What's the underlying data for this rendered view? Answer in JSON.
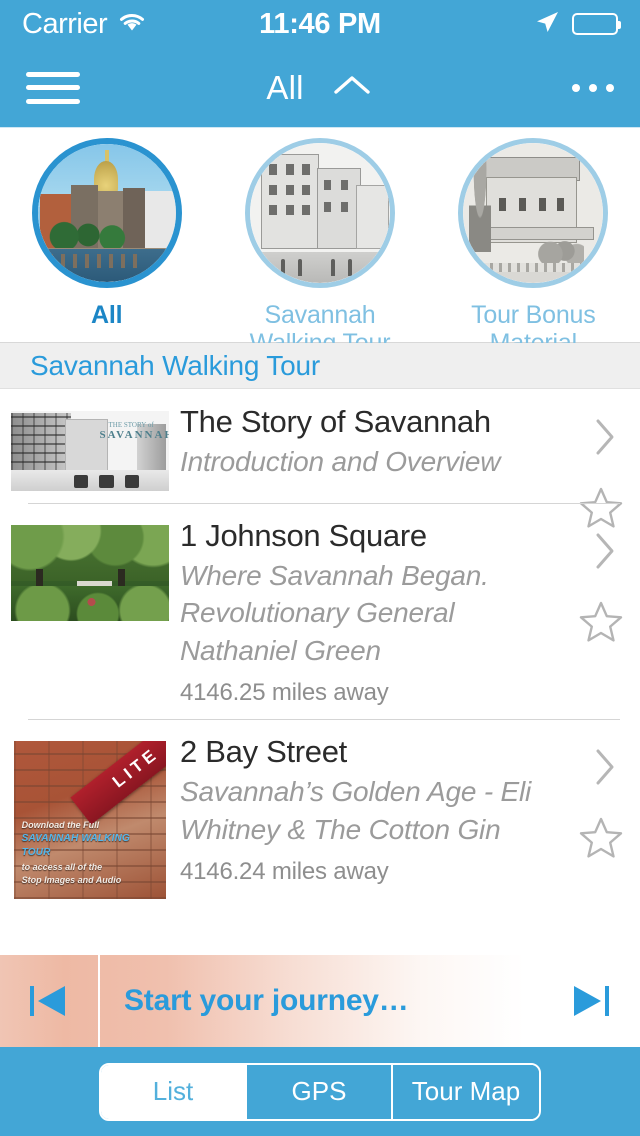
{
  "status_bar": {
    "carrier": "Carrier",
    "wifi_icon": "wifi-icon",
    "time": "11:46 PM",
    "location_icon": "location-arrow-icon",
    "battery_icon": "battery-icon"
  },
  "nav_bar": {
    "menu_icon": "hamburger-menu-icon",
    "title": "All",
    "chevron_icon": "chevron-up-icon",
    "more_icon": "more-options-icon"
  },
  "categories": [
    {
      "label": "All",
      "selected": true,
      "thumb": "savannah-river-street-photo"
    },
    {
      "label": "Savannah Walking Tour",
      "selected": false,
      "thumb": "broughton-street-engraving"
    },
    {
      "label": "Tour Bonus Material",
      "selected": false,
      "thumb": "historic-house-engraving"
    }
  ],
  "section": {
    "title": "Savannah Walking Tour"
  },
  "list": {
    "items": [
      {
        "title": "The Story of Savannah",
        "subtitle": "Introduction and Overview",
        "distance": "",
        "thumb": "vintage-street-photo",
        "thumb_logo_top": "THE STORY of",
        "thumb_logo_main": "SAVANNAH",
        "thumb_logo_sub": "",
        "chevron_icon": "chevron-right-icon",
        "star_icon": "star-outline-icon"
      },
      {
        "title": "1 Johnson Square",
        "subtitle": "Where Savannah Began.  Revolutionary General Nathaniel Green",
        "distance": "4146.25 miles away",
        "thumb": "johnson-square-park-photo",
        "chevron_icon": "chevron-right-icon",
        "star_icon": "star-outline-icon"
      },
      {
        "title": "2 Bay Street",
        "subtitle": "Savannah’s Golden Age  -  Eli Whitney & The Cotton Gin",
        "distance": "4146.24 miles away",
        "thumb": "brick-wall-lite-promo",
        "thumb_badge": "LITE",
        "thumb_promo_line1": "Download the Full",
        "thumb_promo_line2": "SAVANNAH WALKING TOUR",
        "thumb_promo_line3": "to access all of the",
        "thumb_promo_line4": "Stop Images and Audio",
        "chevron_icon": "chevron-right-icon",
        "star_icon": "star-outline-icon"
      }
    ]
  },
  "player": {
    "prev_icon": "skip-previous-icon",
    "message": "Start your journey…",
    "next_icon": "skip-next-icon"
  },
  "tab_bar": {
    "tabs": [
      {
        "label": "List",
        "active": true
      },
      {
        "label": "GPS",
        "active": false
      },
      {
        "label": "Tour Map",
        "active": false
      }
    ]
  },
  "colors": {
    "header_blue": "#43A6D6",
    "accent_blue": "#2A9BDB",
    "light_blue": "#7FC0E2",
    "section_bg": "#EFEFEF",
    "title_gray": "#2b2b2b",
    "subtitle_gray": "#9b9b9b",
    "player_peach": "#eeb9a4",
    "badge_red": "#b0202c"
  }
}
